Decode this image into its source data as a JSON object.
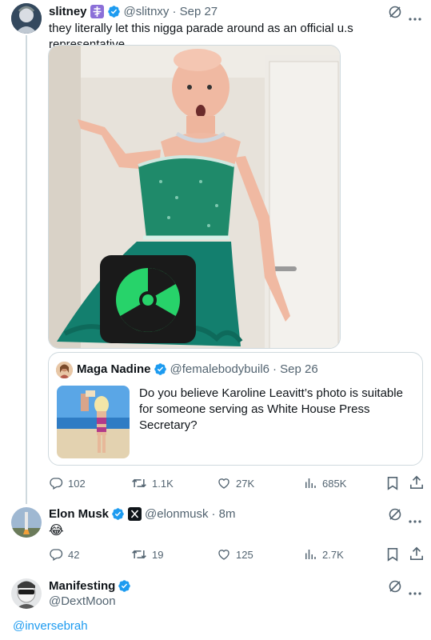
{
  "tweet_main": {
    "display_name": "slitney",
    "handle": "@slitnxy",
    "date": "· Sep 27",
    "text": "they literally let this nigga parade around as an official u.s representative",
    "stats": {
      "replies": "102",
      "reposts": "1.1K",
      "likes": "27K",
      "views": "685K"
    }
  },
  "quote": {
    "display_name": "Maga Nadine",
    "handle": "@femalebodybuil6",
    "date": "· Sep 26",
    "text": "Do you believe Karoline Leavitt’s photo is suitable for someone serving as White House Press Secretary?"
  },
  "reply_1": {
    "display_name": "Elon Musk",
    "handle": "@elonmusk",
    "date": "· 8m",
    "text": "😂",
    "stats": {
      "replies": "42",
      "reposts": "19",
      "likes": "125",
      "views": "2.7K"
    }
  },
  "reply_2": {
    "display_name": "Manifesting",
    "handle": "@DextMoon",
    "text": "@inversebrah"
  },
  "colors": {
    "accent": "#1d9bf0",
    "text_primary": "#0f1419",
    "text_secondary": "#536471",
    "border": "#cfd9de"
  },
  "icons": [
    "reply-icon",
    "repost-icon",
    "like-icon",
    "views-icon",
    "bookmark-icon",
    "share-icon",
    "grok-icon",
    "more-icon",
    "verified-icon"
  ]
}
